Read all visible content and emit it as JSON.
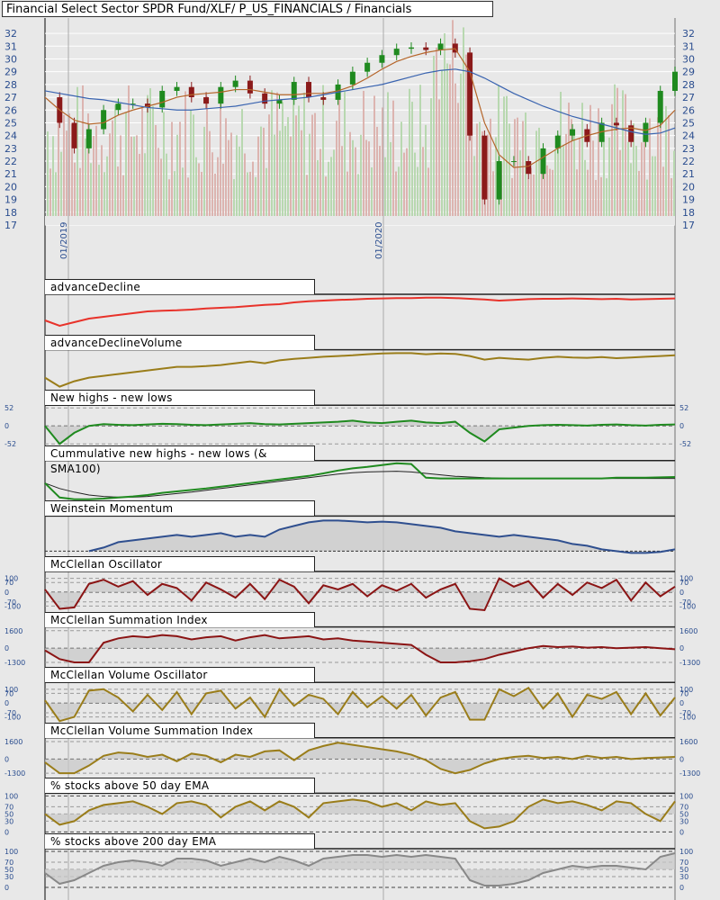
{
  "title": "Financial Select Sector SPDR Fund/XLF/ P_US_FINANCIALS / Financials",
  "colors": {
    "up": "#1f8a1f",
    "down": "#8b1a1a",
    "sma_short": "#b5652a",
    "sma_long": "#3a64b0",
    "red": "#e8322a",
    "olive": "#9a7d1a",
    "green": "#1f8a1f",
    "navy": "#2f4f8f",
    "maroon": "#8b1414",
    "gray": "#888888"
  },
  "chart_data": [
    {
      "type": "candlestick",
      "name": "price",
      "ylim": [
        17,
        32.5
      ],
      "yticks": [
        "17",
        "18",
        "19",
        "20",
        "21",
        "22",
        "23",
        "24",
        "25",
        "26",
        "27",
        "28",
        "29",
        "30",
        "31",
        "32"
      ],
      "xtick_labels": [
        "01/2019",
        "01/2020"
      ],
      "close": [
        27,
        25,
        23,
        24.5,
        26,
        26.5,
        26.5,
        26.2,
        27.5,
        27.8,
        27,
        26.5,
        27.8,
        28.3,
        27.3,
        26.5,
        26.8,
        28.2,
        27,
        26.8,
        28,
        29,
        29.7,
        30.3,
        30.8,
        30.9,
        30.7,
        31.2,
        30.5,
        24,
        19,
        22,
        22,
        21,
        23,
        24,
        24.5,
        23.5,
        25,
        24.8,
        23.5,
        25,
        27.5,
        29
      ],
      "sma_short": [
        27,
        26,
        25.2,
        24.9,
        25,
        25.6,
        26,
        26.3,
        26.6,
        27,
        27.2,
        27.3,
        27.4,
        27.6,
        27.6,
        27.4,
        27.2,
        27.2,
        27.3,
        27.3,
        27.5,
        27.9,
        28.5,
        29.2,
        29.8,
        30.2,
        30.5,
        30.7,
        30.8,
        29,
        25,
        22.5,
        21.5,
        21.6,
        22.3,
        23,
        23.6,
        24,
        24.3,
        24.5,
        24.6,
        24.4,
        24.8,
        26
      ],
      "sma_long": [
        27.5,
        27.3,
        27.1,
        26.9,
        26.8,
        26.6,
        26.4,
        26.2,
        26.1,
        26,
        26,
        26.1,
        26.2,
        26.3,
        26.5,
        26.7,
        26.8,
        26.9,
        27,
        27.2,
        27.4,
        27.6,
        27.8,
        28,
        28.3,
        28.6,
        28.9,
        29.1,
        29.2,
        29,
        28.5,
        27.9,
        27.3,
        26.8,
        26.3,
        25.9,
        25.5,
        25.2,
        24.9,
        24.6,
        24.3,
        24.1,
        24.2,
        24.6
      ]
    },
    {
      "type": "line",
      "name": "advanceDecline",
      "ylim": [
        0,
        1
      ],
      "color": "red",
      "values": [
        0.35,
        0.2,
        0.3,
        0.4,
        0.45,
        0.5,
        0.55,
        0.6,
        0.62,
        0.63,
        0.65,
        0.68,
        0.7,
        0.72,
        0.75,
        0.78,
        0.8,
        0.85,
        0.88,
        0.9,
        0.92,
        0.93,
        0.95,
        0.96,
        0.97,
        0.97,
        0.98,
        0.98,
        0.97,
        0.95,
        0.93,
        0.9,
        0.92,
        0.94,
        0.95,
        0.95,
        0.96,
        0.95,
        0.94,
        0.95,
        0.93,
        0.94,
        0.95,
        0.96
      ]
    },
    {
      "type": "line",
      "name": "advanceDeclineVolume",
      "ylim": [
        0,
        1
      ],
      "color": "olive",
      "values": [
        0.3,
        0.05,
        0.2,
        0.3,
        0.35,
        0.4,
        0.45,
        0.5,
        0.55,
        0.6,
        0.6,
        0.62,
        0.65,
        0.7,
        0.75,
        0.7,
        0.78,
        0.82,
        0.85,
        0.88,
        0.9,
        0.92,
        0.95,
        0.97,
        0.98,
        0.98,
        0.95,
        0.97,
        0.96,
        0.9,
        0.8,
        0.85,
        0.82,
        0.8,
        0.85,
        0.88,
        0.86,
        0.85,
        0.87,
        0.84,
        0.86,
        0.88,
        0.9,
        0.92
      ]
    },
    {
      "type": "line",
      "name": "New highs - new lows",
      "ylim": [
        -52,
        52
      ],
      "ticks": [
        "52",
        "0",
        "-52"
      ],
      "color": "green",
      "values": [
        0,
        -52,
        -20,
        0,
        5,
        3,
        2,
        4,
        6,
        5,
        3,
        2,
        4,
        6,
        8,
        5,
        4,
        6,
        8,
        10,
        12,
        15,
        10,
        8,
        12,
        15,
        10,
        8,
        12,
        -20,
        -45,
        -10,
        -5,
        0,
        2,
        3,
        2,
        1,
        3,
        4,
        2,
        1,
        3,
        4
      ]
    },
    {
      "type": "line",
      "name": "Cummulative new highs - new lows (& SMA100)",
      "ylim": [
        0,
        1
      ],
      "color": "green",
      "values": [
        0.45,
        0.05,
        0,
        0,
        0.02,
        0.05,
        0.08,
        0.12,
        0.18,
        0.22,
        0.26,
        0.3,
        0.35,
        0.4,
        0.45,
        0.5,
        0.55,
        0.6,
        0.65,
        0.72,
        0.8,
        0.86,
        0.9,
        0.95,
        1,
        0.98,
        0.6,
        0.58,
        0.58,
        0.58,
        0.58,
        0.58,
        0.58,
        0.58,
        0.58,
        0.58,
        0.58,
        0.58,
        0.58,
        0.6,
        0.6,
        0.6,
        0.61,
        0.62
      ],
      "sma": [
        0.45,
        0.3,
        0.2,
        0.12,
        0.08,
        0.06,
        0.06,
        0.08,
        0.12,
        0.16,
        0.2,
        0.25,
        0.3,
        0.35,
        0.4,
        0.45,
        0.5,
        0.55,
        0.6,
        0.65,
        0.7,
        0.74,
        0.76,
        0.77,
        0.78,
        0.76,
        0.72,
        0.68,
        0.64,
        0.62,
        0.6,
        0.59,
        0.58,
        0.58,
        0.58,
        0.58,
        0.58,
        0.58,
        0.58,
        0.58,
        0.58,
        0.58,
        0.58,
        0.58
      ]
    },
    {
      "type": "line",
      "name": "Weinstein Momentum",
      "ylim": [
        0,
        1
      ],
      "color": "navy",
      "values": [
        null,
        null,
        null,
        0.1,
        0.2,
        0.35,
        0.4,
        0.45,
        0.5,
        0.55,
        0.5,
        0.55,
        0.6,
        0.5,
        0.55,
        0.5,
        0.7,
        0.8,
        0.9,
        0.95,
        0.95,
        0.93,
        0.9,
        0.92,
        0.9,
        0.85,
        0.8,
        0.75,
        0.65,
        0.6,
        0.55,
        0.5,
        0.55,
        0.5,
        0.45,
        0.4,
        0.3,
        0.25,
        0.15,
        0.1,
        0.05,
        0.05,
        0.08,
        0.15
      ]
    },
    {
      "type": "line",
      "name": "McClellan Oscillator",
      "ylim": [
        -130,
        130
      ],
      "ticks": [
        "100",
        "70",
        "0",
        "-70",
        "-100"
      ],
      "color": "maroon",
      "values": [
        20,
        -120,
        -110,
        60,
        90,
        40,
        80,
        -20,
        60,
        30,
        -60,
        70,
        20,
        -40,
        60,
        -50,
        90,
        40,
        -80,
        50,
        20,
        60,
        -30,
        50,
        10,
        60,
        -40,
        20,
        60,
        -120,
        -130,
        100,
        40,
        80,
        -40,
        60,
        -20,
        70,
        30,
        90,
        -60,
        70,
        -30,
        40
      ]
    },
    {
      "type": "line",
      "name": "McClellan Summation Index",
      "ylim": [
        -1600,
        1700
      ],
      "ticks": [
        "1600",
        "0",
        "-1300"
      ],
      "color": "maroon",
      "values": [
        -200,
        -1000,
        -1300,
        -1300,
        500,
        900,
        1100,
        1000,
        1200,
        1100,
        800,
        1000,
        1100,
        700,
        1000,
        1200,
        900,
        1000,
        1100,
        800,
        900,
        700,
        600,
        500,
        400,
        300,
        -600,
        -1300,
        -1300,
        -1200,
        -1000,
        -600,
        -300,
        0,
        200,
        100,
        150,
        50,
        100,
        0,
        50,
        100,
        0,
        -100
      ]
    },
    {
      "type": "line",
      "name": "McClellan Volume Oscillator",
      "ylim": [
        -130,
        130
      ],
      "ticks": [
        "100",
        "70",
        "0",
        "-70",
        "-100"
      ],
      "color": "olive",
      "values": [
        20,
        -130,
        -100,
        90,
        100,
        40,
        -60,
        60,
        -50,
        80,
        -80,
        70,
        90,
        -40,
        40,
        -100,
        100,
        -20,
        60,
        30,
        -80,
        80,
        -30,
        50,
        -40,
        60,
        -90,
        40,
        80,
        -120,
        -120,
        100,
        50,
        110,
        -40,
        70,
        -100,
        60,
        30,
        80,
        -80,
        70,
        -90,
        40
      ]
    },
    {
      "type": "line",
      "name": "McClellan Volume Summation Index",
      "ylim": [
        -1600,
        1700
      ],
      "ticks": [
        "1600",
        "0",
        "-1300"
      ],
      "color": "olive",
      "values": [
        -300,
        -1300,
        -1300,
        -600,
        300,
        600,
        500,
        200,
        400,
        -200,
        500,
        300,
        -300,
        400,
        200,
        700,
        800,
        -100,
        800,
        1200,
        1500,
        1300,
        1100,
        900,
        700,
        400,
        -100,
        -900,
        -1300,
        -1000,
        -400,
        0,
        200,
        300,
        100,
        200,
        0,
        300,
        100,
        200,
        0,
        100,
        150,
        200
      ]
    },
    {
      "type": "line",
      "name": "% stocks above 50 day EMA",
      "ylim": [
        0,
        100
      ],
      "ticks": [
        "100",
        "70",
        "50",
        "30",
        "0"
      ],
      "color": "olive",
      "values": [
        50,
        20,
        30,
        60,
        75,
        80,
        85,
        70,
        50,
        80,
        85,
        75,
        40,
        70,
        85,
        60,
        85,
        70,
        40,
        80,
        85,
        90,
        85,
        70,
        80,
        60,
        85,
        75,
        80,
        30,
        10,
        15,
        30,
        70,
        90,
        80,
        85,
        75,
        60,
        85,
        80,
        50,
        30,
        85
      ]
    },
    {
      "type": "line",
      "name": "% stocks above 200 day EMA",
      "ylim": [
        0,
        100
      ],
      "ticks": [
        "100",
        "70",
        "50",
        "30",
        "0"
      ],
      "color": "gray",
      "values": [
        40,
        10,
        20,
        40,
        60,
        70,
        75,
        70,
        60,
        80,
        80,
        75,
        60,
        70,
        80,
        70,
        85,
        75,
        60,
        80,
        85,
        90,
        90,
        85,
        90,
        85,
        90,
        85,
        80,
        20,
        5,
        5,
        10,
        20,
        40,
        50,
        60,
        55,
        60,
        60,
        55,
        50,
        85,
        95
      ]
    }
  ]
}
